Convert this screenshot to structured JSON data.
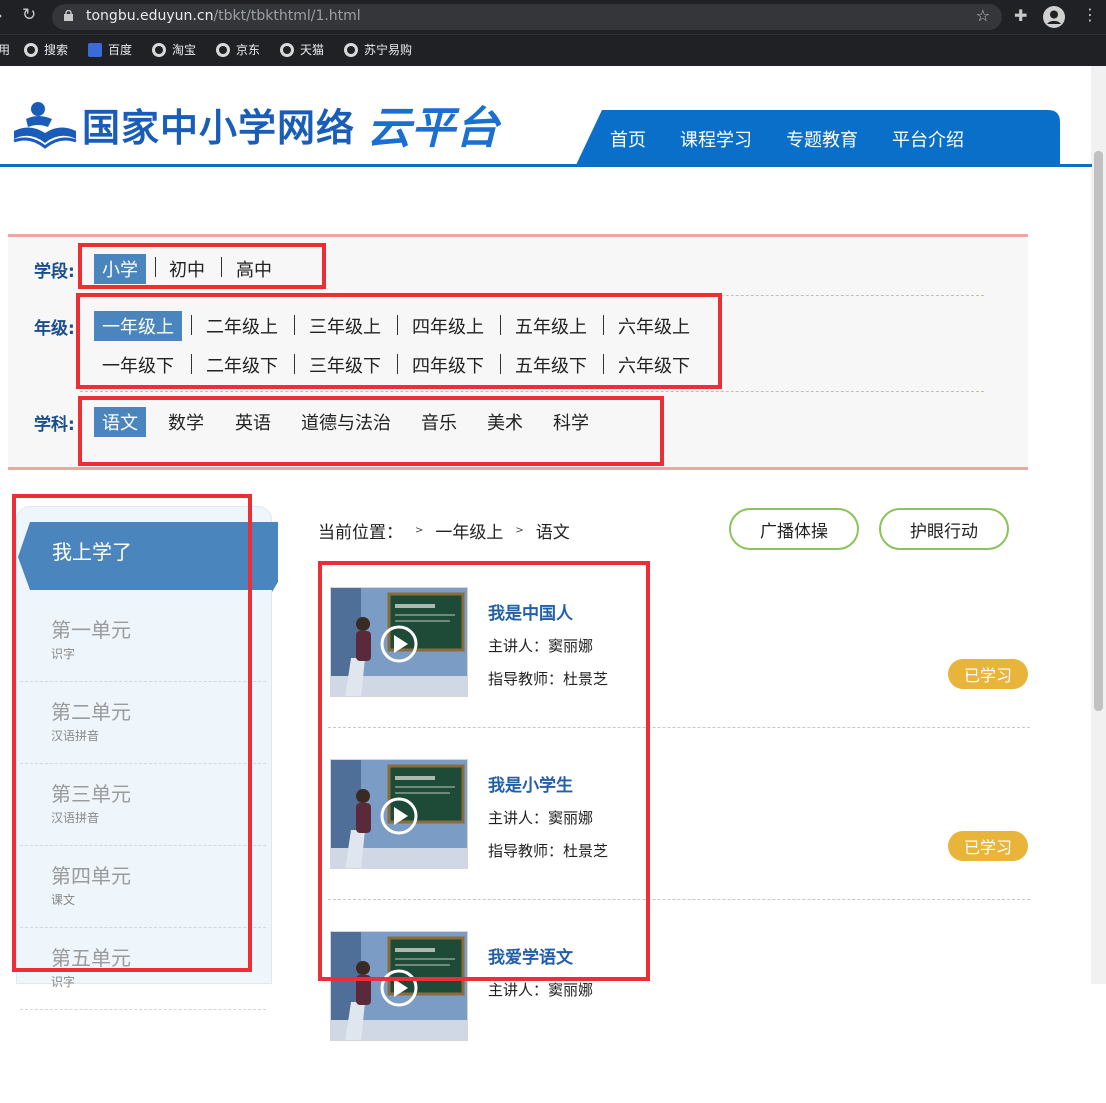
{
  "browser": {
    "url_host": "tongbu.eduyun.cn",
    "url_path": "/tbkt/tbkthtml/1.html",
    "bookmark_cut": "用",
    "bookmarks": [
      "搜索",
      "百度",
      "淘宝",
      "京东",
      "天猫",
      "苏宁易购"
    ]
  },
  "site": {
    "logo_text": "国家中小学网络",
    "logo_cloud": "云平台",
    "nav": [
      "首页",
      "课程学习",
      "专题教育",
      "平台介绍"
    ]
  },
  "filters": {
    "stage_label": "学段:",
    "stages": [
      "小学",
      "初中",
      "高中"
    ],
    "grade_label": "年级:",
    "grades_row1": [
      "一年级上",
      "二年级上",
      "三年级上",
      "四年级上",
      "五年级上",
      "六年级上"
    ],
    "grades_row2": [
      "一年级下",
      "二年级下",
      "三年级下",
      "四年级下",
      "五年级下",
      "六年级下"
    ],
    "subject_label": "学科:",
    "subjects": [
      "语文",
      "数学",
      "英语",
      "道德与法治",
      "音乐",
      "美术",
      "科学"
    ]
  },
  "sidebar": {
    "active": "我上学了",
    "units": [
      {
        "title": "第一单元",
        "sub": "识字"
      },
      {
        "title": "第二单元",
        "sub": "汉语拼音"
      },
      {
        "title": "第三单元",
        "sub": "汉语拼音"
      },
      {
        "title": "第四单元",
        "sub": "课文"
      },
      {
        "title": "第五单元",
        "sub": "识字"
      }
    ]
  },
  "main": {
    "crumb_label": "当前位置：",
    "crumb_grade": "一年级上",
    "crumb_subject": "语文",
    "btn_broadcast": "广播体操",
    "btn_eye": "护眼行动",
    "lessons": [
      {
        "title": "我是中国人",
        "lecturer": "主讲人：窦丽娜",
        "teacher": "指导教师：杜景芝",
        "status": "已学习"
      },
      {
        "title": "我是小学生",
        "lecturer": "主讲人：窦丽娜",
        "teacher": "指导教师：杜景芝",
        "status": "已学习"
      },
      {
        "title": "我爱学语文",
        "lecturer": "主讲人：窦丽娜",
        "teacher": "",
        "status": ""
      }
    ]
  },
  "colors": {
    "brand_blue": "#0a6fc8",
    "selected_blue": "#4a86bd",
    "annotation_red": "#ee2e35",
    "badge_gold": "#e8b43a",
    "pill_green": "#8bc35a"
  }
}
